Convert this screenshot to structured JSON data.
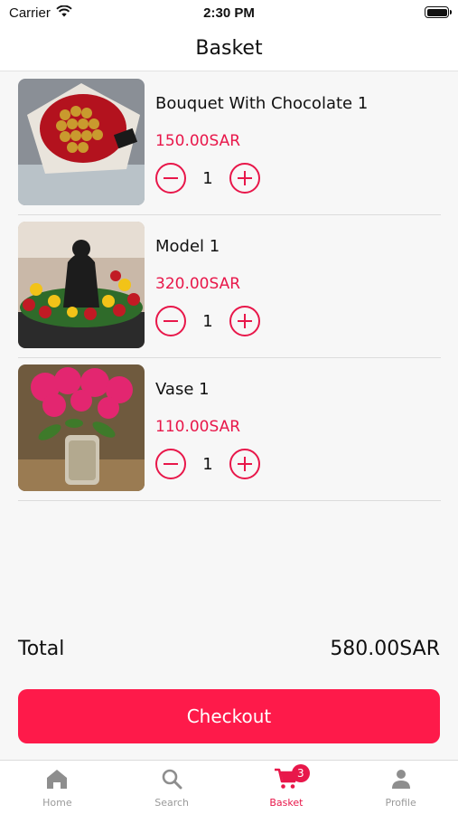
{
  "status_bar": {
    "carrier": "Carrier",
    "time": "2:30 PM"
  },
  "header": {
    "title": "Basket"
  },
  "items": [
    {
      "name": "Bouquet With Chocolate 1",
      "price": "150.00SAR",
      "quantity": "1",
      "image": "bouquet-chocolate-photo"
    },
    {
      "name": "Model 1",
      "price": "320.00SAR",
      "quantity": "1",
      "image": "flower-model-photo"
    },
    {
      "name": "Vase 1",
      "price": "110.00SAR",
      "quantity": "1",
      "image": "pink-flower-vase-photo"
    }
  ],
  "summary": {
    "total_label": "Total",
    "total_value": "580.00SAR"
  },
  "checkout": {
    "label": "Checkout"
  },
  "tabbar": {
    "tabs": [
      {
        "label": "Home",
        "icon": "home-icon"
      },
      {
        "label": "Search",
        "icon": "search-icon"
      },
      {
        "label": "Basket",
        "icon": "cart-icon",
        "badge": "3",
        "active": true
      },
      {
        "label": "Profile",
        "icon": "person-icon"
      }
    ]
  },
  "colors": {
    "accent": "#e8174a",
    "checkout": "#fe1a4a",
    "inactive": "#9a9a9a",
    "background": "#f7f7f7"
  }
}
